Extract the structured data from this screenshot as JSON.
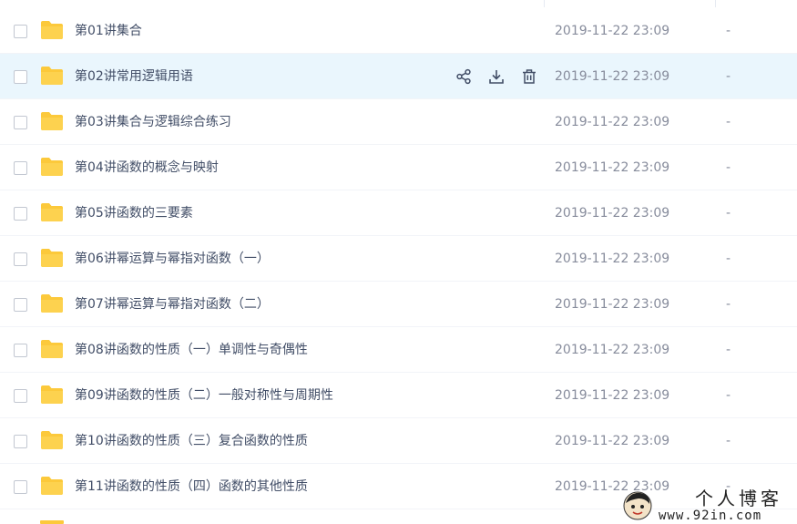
{
  "files": [
    {
      "name": "第01讲集合",
      "modified": "2019-11-22 23:09",
      "size": "-"
    },
    {
      "name": "第02讲常用逻辑用语",
      "modified": "2019-11-22 23:09",
      "size": "-"
    },
    {
      "name": "第03讲集合与逻辑综合练习",
      "modified": "2019-11-22 23:09",
      "size": "-"
    },
    {
      "name": "第04讲函数的概念与映射",
      "modified": "2019-11-22 23:09",
      "size": "-"
    },
    {
      "name": "第05讲函数的三要素",
      "modified": "2019-11-22 23:09",
      "size": "-"
    },
    {
      "name": "第06讲幂运算与幂指对函数（一）",
      "modified": "2019-11-22 23:09",
      "size": "-"
    },
    {
      "name": "第07讲幂运算与幂指对函数（二）",
      "modified": "2019-11-22 23:09",
      "size": "-"
    },
    {
      "name": "第08讲函数的性质（一）单调性与奇偶性",
      "modified": "2019-11-22 23:09",
      "size": "-"
    },
    {
      "name": "第09讲函数的性质（二）一般对称性与周期性",
      "modified": "2019-11-22 23:09",
      "size": "-"
    },
    {
      "name": "第10讲函数的性质（三）复合函数的性质",
      "modified": "2019-11-22 23:09",
      "size": "-"
    },
    {
      "name": "第11讲函数的性质（四）函数的其他性质",
      "modified": "2019-11-22 23:09",
      "size": "-"
    }
  ],
  "hovered_row_index": 1,
  "row_actions": {
    "share_icon": "share-icon",
    "download_icon": "download-icon",
    "delete_icon": "trash-icon"
  },
  "watermark": {
    "title": "个人博客",
    "url": "www.92in.com"
  },
  "colors": {
    "folder": "#fcc93b",
    "hover_bg": "#eaf6fd",
    "text": "#424e67",
    "muted_text": "#878c9c"
  }
}
